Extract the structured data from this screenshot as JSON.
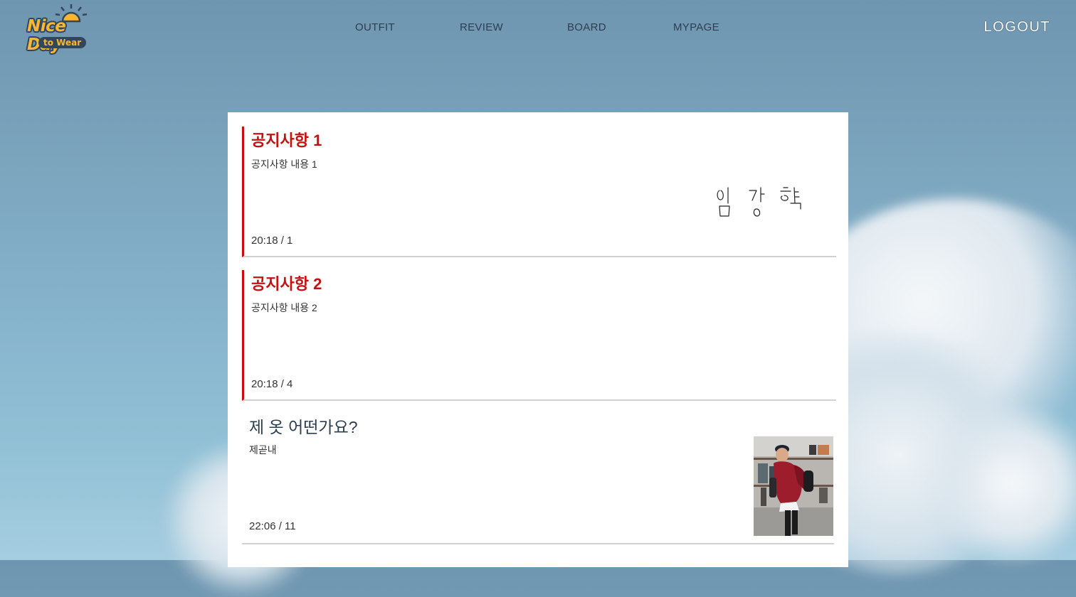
{
  "brand": {
    "logo_main": "Nice Day",
    "logo_sub": "to Wear"
  },
  "nav": {
    "items": [
      {
        "label": "OUTFIT"
      },
      {
        "label": "REVIEW"
      },
      {
        "label": "BOARD"
      },
      {
        "label": "MYPAGE"
      }
    ],
    "logout": "LOGOUT"
  },
  "posts": [
    {
      "type": "notice",
      "title": "공지사항 1",
      "body": "공지사항 내용 1",
      "meta": "20:18 / 1",
      "thumbnail": "handwritten-signature"
    },
    {
      "type": "notice",
      "title": "공지사항 2",
      "body": "공지사항 내용 2",
      "meta": "20:18 / 4"
    },
    {
      "type": "post",
      "title": "제 옷 어떤가요?",
      "body": "제곧내",
      "meta": "22:06 / 11",
      "thumbnail": "outfit-photo"
    }
  ],
  "colors": {
    "notice_accent": "#c80f0f",
    "nav_text": "#2c3e50",
    "logo_yellow": "#f7b731",
    "logo_outline": "#33475a"
  }
}
